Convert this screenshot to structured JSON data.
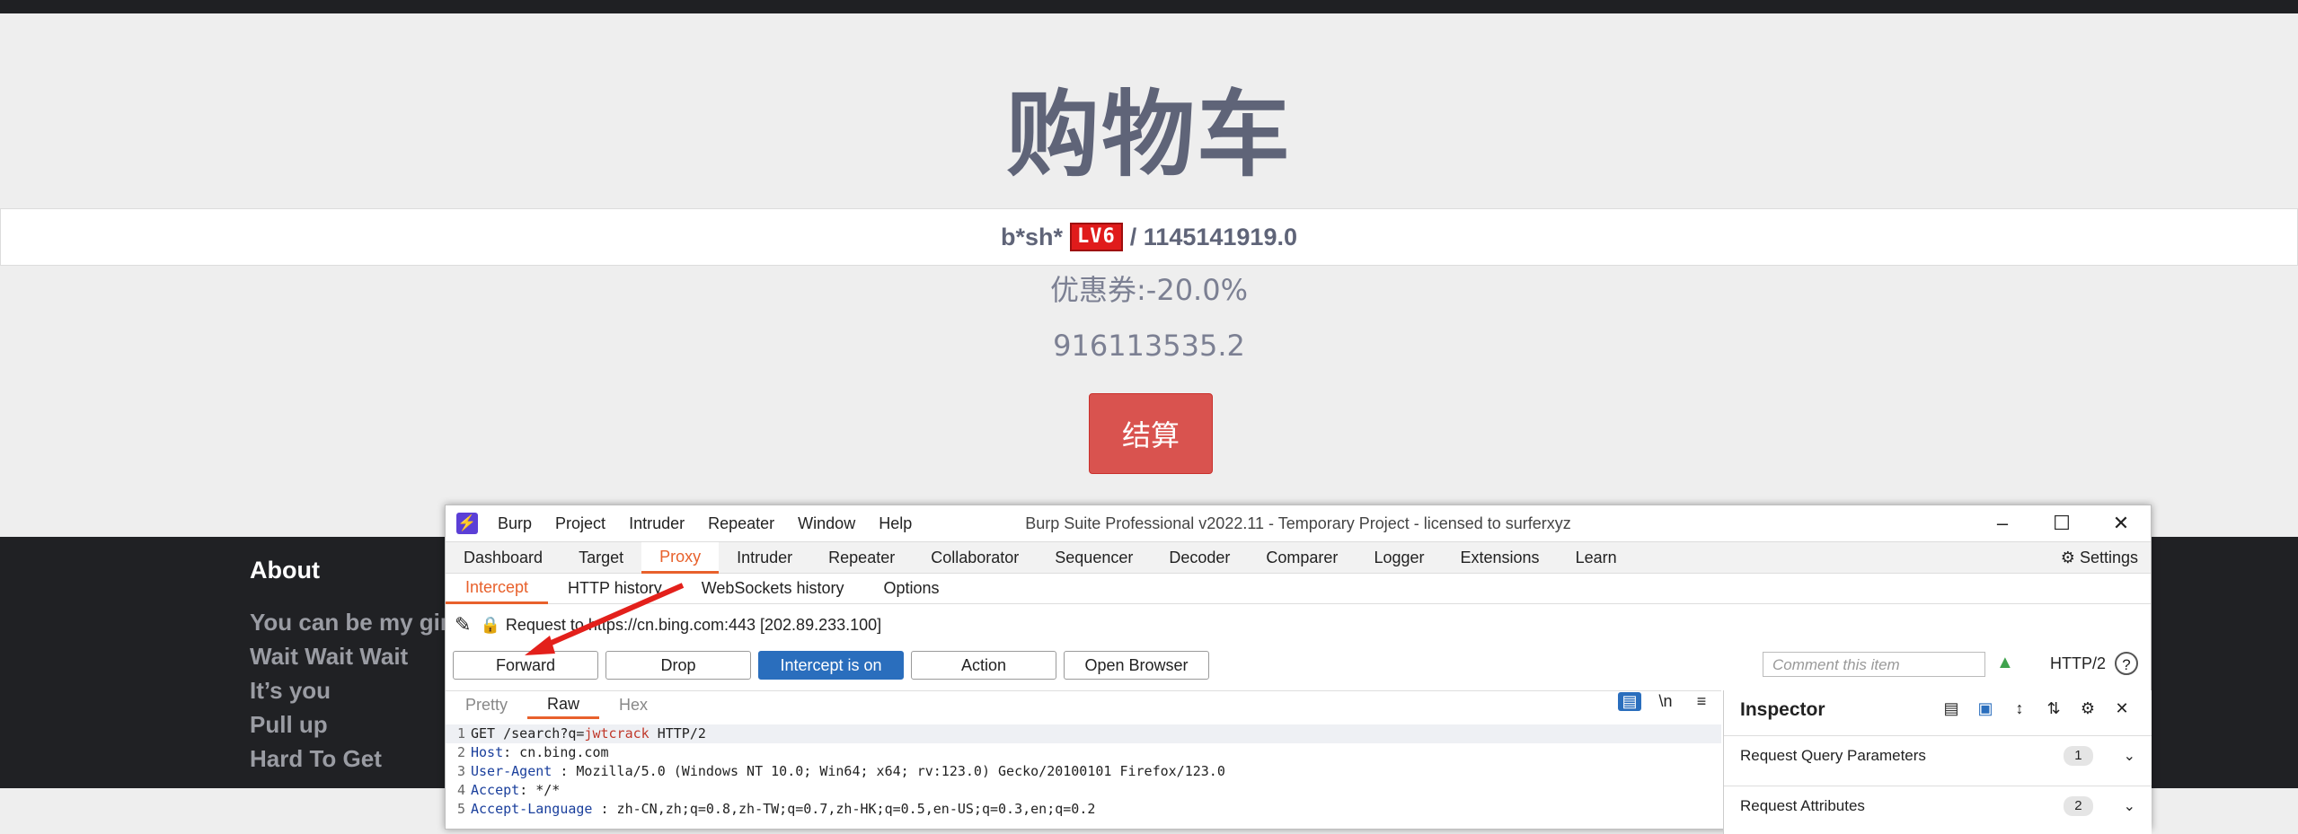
{
  "page": {
    "title": "购物车",
    "user_name": "b*sh*",
    "level_badge": "LV6",
    "balance": "/ 1145141919.0",
    "coupon": "优惠券:-20.0%",
    "amount": "916113535.2",
    "checkout_label": "结算"
  },
  "footer": {
    "about_title": "About",
    "items": [
      "You can be my gir",
      "Wait Wait Wait",
      "It’s you",
      "Pull up",
      "Hard To Get"
    ]
  },
  "burp": {
    "logo_glyph": "⚡",
    "menu": [
      "Burp",
      "Project",
      "Intruder",
      "Repeater",
      "Window",
      "Help"
    ],
    "window_title": "Burp Suite Professional v2022.11 - Temporary Project - licensed to surferxyz",
    "tabs": [
      "Dashboard",
      "Target",
      "Proxy",
      "Intruder",
      "Repeater",
      "Collaborator",
      "Sequencer",
      "Decoder",
      "Comparer",
      "Logger",
      "Extensions",
      "Learn"
    ],
    "settings_label": "Settings",
    "subtabs": [
      "Intercept",
      "HTTP history",
      "WebSockets history",
      "Options"
    ],
    "request_to": "Request to https://cn.bing.com:443  [202.89.233.100]",
    "buttons": {
      "forward": "Forward",
      "drop": "Drop",
      "intercept": "Intercept is on",
      "action": "Action",
      "open_browser": "Open Browser"
    },
    "comment_placeholder": "Comment this item",
    "http_version": "HTTP/2",
    "help_glyph": "?",
    "editor_tabs": [
      "Pretty",
      "Raw",
      "Hex"
    ],
    "editor_icons": {
      "wrap": "▤",
      "newline": "\\n",
      "menu": "≡"
    },
    "code": {
      "l1_a": "GET /search?q=",
      "l1_b": "jwtcrack",
      "l1_c": " HTTP/2",
      "l2_k": "Host",
      "l2_v": ": cn.bing.com",
      "l3_k": "User-Agent",
      "l3_v": " : Mozilla/5.0 (Windows NT 10.0; Win64; x64; rv:123.0) Gecko/20100101 Firefox/123.0",
      "l4_k": "Accept",
      "l4_v": ": */*",
      "l5_k": "Accept-Language",
      "l5_v": " : zh-CN,zh;q=0.8,zh-TW;q=0.7,zh-HK;q=0.5,en-US;q=0.3,en;q=0.2",
      "line_numbers": [
        "1",
        "2",
        "3",
        "4",
        "5"
      ]
    },
    "inspector": {
      "title": "Inspector",
      "rows": [
        {
          "label": "Request Query Parameters",
          "count": "1"
        },
        {
          "label": "Request Attributes",
          "count": "2"
        }
      ]
    },
    "accent": "#e8612c"
  }
}
